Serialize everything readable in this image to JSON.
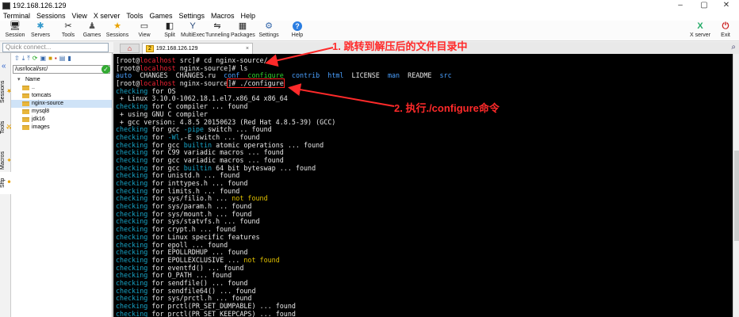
{
  "window": {
    "title": "192.168.126.129",
    "controls": [
      "–",
      "▢",
      "✕"
    ]
  },
  "menu": [
    "Terminal",
    "Sessions",
    "View",
    "X server",
    "Tools",
    "Games",
    "Settings",
    "Macros",
    "Help"
  ],
  "toolbar": [
    {
      "label": "Session",
      "icon": "session-icon"
    },
    {
      "label": "Servers",
      "icon": "servers-icon"
    },
    {
      "label": "Tools",
      "icon": "tools-icon"
    },
    {
      "label": "Games",
      "icon": "games-icon"
    },
    {
      "label": "Sessions",
      "icon": "sessions-star-icon"
    },
    {
      "label": "View",
      "icon": "view-icon"
    },
    {
      "label": "Split",
      "icon": "split-icon"
    },
    {
      "label": "MultiExec",
      "icon": "multiexec-icon"
    },
    {
      "label": "Tunneling",
      "icon": "tunneling-icon"
    },
    {
      "label": "Packages",
      "icon": "packages-icon"
    },
    {
      "label": "Settings",
      "icon": "settings-icon"
    },
    {
      "label": "Help",
      "icon": "help-icon"
    }
  ],
  "toolbar_right": [
    {
      "label": "X server",
      "icon": "x-server-icon"
    },
    {
      "label": "Exit",
      "icon": "exit-icon"
    }
  ],
  "quick_connect": {
    "placeholder": "Quick connect..."
  },
  "session_tab": {
    "number": "2",
    "label": "192.168.126.129",
    "close": "×"
  },
  "side_tabs": [
    "Sessions",
    "Tools",
    "Macros",
    "Sftp"
  ],
  "sftp": {
    "path": "/usr/local/src/",
    "header": "Name",
    "items": [
      "..",
      "tomcats",
      "nginx-source",
      "mysql8",
      "jdk16",
      "images"
    ],
    "selected_index": 2
  },
  "terminal": {
    "lines": [
      [
        {
          "t": "[root@"
        },
        {
          "t": "localhost",
          "c": "hl"
        },
        {
          "t": " src]# cd nginx-source/"
        }
      ],
      [
        {
          "t": "[root@"
        },
        {
          "t": "localhost",
          "c": "hl"
        },
        {
          "t": " nginx-source]# ls"
        }
      ],
      [
        {
          "t": "auto",
          "c": "b"
        },
        {
          "t": "  CHANGES  CHANGES.ru  "
        },
        {
          "t": "conf",
          "c": "b"
        },
        {
          "t": "  "
        },
        {
          "t": "configure",
          "c": "g"
        },
        {
          "t": "  "
        },
        {
          "t": "contrib",
          "c": "b"
        },
        {
          "t": "  "
        },
        {
          "t": "html",
          "c": "b"
        },
        {
          "t": "  LICENSE  "
        },
        {
          "t": "man",
          "c": "b"
        },
        {
          "t": "  README  "
        },
        {
          "t": "src",
          "c": "b"
        }
      ],
      [
        {
          "t": "[root@"
        },
        {
          "t": "localhost",
          "c": "hl"
        },
        {
          "t": " nginx-source"
        },
        {
          "t": "]# ./configure",
          "box": true
        }
      ],
      [
        {
          "t": "checking",
          "c": "c"
        },
        {
          "t": " for OS"
        }
      ],
      [
        {
          "t": " + Linux 3.10.0-1062.18.1.el7.x86_64 x86_64"
        }
      ],
      [
        {
          "t": "checking",
          "c": "c"
        },
        {
          "t": " for C compiler ... found"
        }
      ],
      [
        {
          "t": " + using GNU C compiler"
        }
      ],
      [
        {
          "t": " + gcc version: 4.8.5 20150623 (Red Hat 4.8.5-39) (GCC)"
        }
      ],
      [
        {
          "t": "checking",
          "c": "c"
        },
        {
          "t": " for gcc "
        },
        {
          "t": "-pipe",
          "c": "c"
        },
        {
          "t": " switch ... found"
        }
      ],
      [
        {
          "t": "checking",
          "c": "c"
        },
        {
          "t": " for "
        },
        {
          "t": "-Wl",
          "c": "c"
        },
        {
          "t": ",-E switch ... found"
        }
      ],
      [
        {
          "t": "checking",
          "c": "c"
        },
        {
          "t": " for gcc "
        },
        {
          "t": "builtin",
          "c": "c"
        },
        {
          "t": " atomic operations ... found"
        }
      ],
      [
        {
          "t": "checking",
          "c": "c"
        },
        {
          "t": " for C99 variadic macros ... found"
        }
      ],
      [
        {
          "t": "checking",
          "c": "c"
        },
        {
          "t": " for gcc variadic macros ... found"
        }
      ],
      [
        {
          "t": "checking",
          "c": "c"
        },
        {
          "t": " for gcc "
        },
        {
          "t": "builtin",
          "c": "c"
        },
        {
          "t": " 64 bit byteswap ... found"
        }
      ],
      [
        {
          "t": "checking",
          "c": "c"
        },
        {
          "t": " for unistd.h ... found"
        }
      ],
      [
        {
          "t": "checking",
          "c": "c"
        },
        {
          "t": " for inttypes.h ... found"
        }
      ],
      [
        {
          "t": "checking",
          "c": "c"
        },
        {
          "t": " for limits.h ... found"
        }
      ],
      [
        {
          "t": "checking",
          "c": "c"
        },
        {
          "t": " for sys/filio.h ... "
        },
        {
          "t": "not found",
          "c": "nf"
        }
      ],
      [
        {
          "t": "checking",
          "c": "c"
        },
        {
          "t": " for sys/param.h ... found"
        }
      ],
      [
        {
          "t": "checking",
          "c": "c"
        },
        {
          "t": " for sys/mount.h ... found"
        }
      ],
      [
        {
          "t": "checking",
          "c": "c"
        },
        {
          "t": " for sys/statvfs.h ... found"
        }
      ],
      [
        {
          "t": "checking",
          "c": "c"
        },
        {
          "t": " for crypt.h ... found"
        }
      ],
      [
        {
          "t": "checking",
          "c": "c"
        },
        {
          "t": " for Linux specific features"
        }
      ],
      [
        {
          "t": "checking",
          "c": "c"
        },
        {
          "t": " for epoll ... found"
        }
      ],
      [
        {
          "t": "checking",
          "c": "c"
        },
        {
          "t": " for EPOLLRDHUP ... found"
        }
      ],
      [
        {
          "t": "checking",
          "c": "c"
        },
        {
          "t": " for EPOLLEXCLUSIVE ... "
        },
        {
          "t": "not found",
          "c": "nf"
        }
      ],
      [
        {
          "t": "checking",
          "c": "c"
        },
        {
          "t": " for eventfd() ... found"
        }
      ],
      [
        {
          "t": "checking",
          "c": "c"
        },
        {
          "t": " for O_PATH ... found"
        }
      ],
      [
        {
          "t": "checking",
          "c": "c"
        },
        {
          "t": " for sendfile() ... found"
        }
      ],
      [
        {
          "t": "checking",
          "c": "c"
        },
        {
          "t": " for sendfile64() ... found"
        }
      ],
      [
        {
          "t": "checking",
          "c": "c"
        },
        {
          "t": " for sys/prctl.h ... found"
        }
      ],
      [
        {
          "t": "checking",
          "c": "c"
        },
        {
          "t": " for prctl(PR_SET_DUMPABLE) ... found"
        }
      ],
      [
        {
          "t": "checking",
          "c": "c"
        },
        {
          "t": " for prctl(PR_SET_KEEPCAPS) ... found"
        }
      ]
    ]
  },
  "annotations": {
    "step1": "1. 跳转到解压后的文件目录中",
    "step2": "2. 执行./configure命令",
    "color": "#ff2a2a"
  },
  "colors": {
    "terminal_bg": "#000000",
    "cyan": "#18a6c9",
    "blue": "#4aa0ff",
    "green": "#2fd52f",
    "yellow": "#e0c000",
    "red": "#ee2233"
  }
}
